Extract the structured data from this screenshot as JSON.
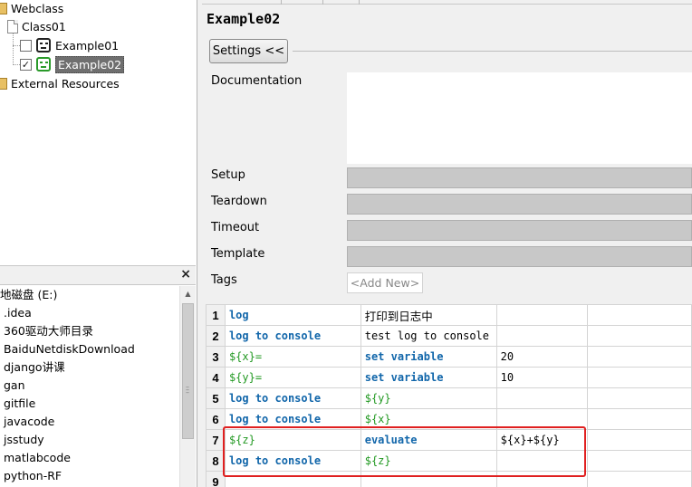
{
  "tree": {
    "webclass": "Webclass",
    "class01": "Class01",
    "example01": "Example01",
    "example02": "Example02",
    "external": "External Resources",
    "checkmark": "✓"
  },
  "files": {
    "close": "×",
    "drive": "地磁盘 (E:)",
    "items": [
      ".idea",
      "360驱动大师目录",
      "BaiduNetdiskDownload",
      "django讲课",
      "gan",
      "gitfile",
      "javacode",
      "jsstudy",
      "matlabcode",
      "python-RF"
    ]
  },
  "editor": {
    "title": "Example02",
    "settings_button": "Settings <<",
    "documentation": "Documentation",
    "setup": "Setup",
    "teardown": "Teardown",
    "timeout": "Timeout",
    "template": "Template",
    "tags": "Tags",
    "add_new": "<Add New>"
  },
  "grid": {
    "rows": [
      {
        "num": "1",
        "c1": "log",
        "c2": "打印到日志中",
        "c3": ""
      },
      {
        "num": "2",
        "c1": "log to console",
        "c2": "test log to console",
        "c3": ""
      },
      {
        "num": "3",
        "c1": "${x}=",
        "c2": "set variable",
        "c3": "20"
      },
      {
        "num": "4",
        "c1": "${y}=",
        "c2": "set variable",
        "c3": "10"
      },
      {
        "num": "5",
        "c1": "log to console",
        "c2": "${y}",
        "c3": ""
      },
      {
        "num": "6",
        "c1": "log to console",
        "c2": "${x}",
        "c3": ""
      },
      {
        "num": "7",
        "c1": "${z}",
        "c2": "evaluate",
        "c3": "${x}+${y}"
      },
      {
        "num": "8",
        "c1": "log to console",
        "c2": "${z}",
        "c3": ""
      },
      {
        "num": "9",
        "c1": "",
        "c2": "",
        "c3": ""
      }
    ]
  },
  "colors": {
    "keyword": "#1166aa",
    "variable": "#229922",
    "highlight": "#e02020",
    "selection": "#6f6f6f"
  }
}
